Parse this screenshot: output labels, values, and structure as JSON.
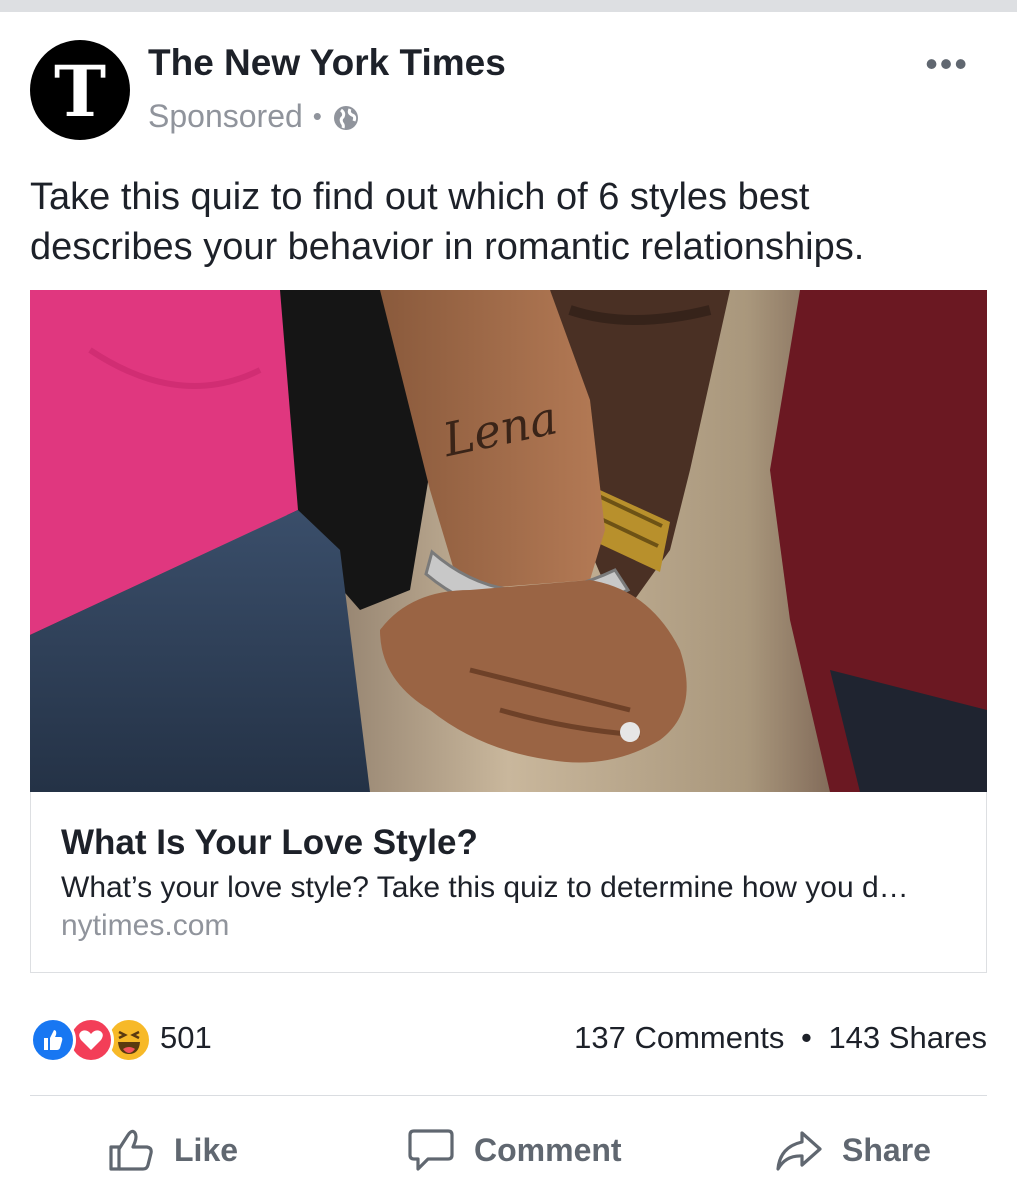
{
  "post": {
    "page_name": "The New York Times",
    "avatar_glyph": "T",
    "sponsored_label": "Sponsored",
    "meta_separator": "•",
    "visibility_icon": "globe-icon",
    "more_label": "•••",
    "text": "Take this quiz to find out which of 6 styles best describes your behavior in romantic relationships."
  },
  "link_card": {
    "image_tattoo_text": "Lena",
    "title": "What Is Your Love Style?",
    "description": "What’s your love style? Take this quiz to determine how you d…",
    "domain": "nytimes.com"
  },
  "engagement": {
    "reaction_icons": [
      "like-reaction-icon",
      "love-reaction-icon",
      "haha-reaction-icon"
    ],
    "reaction_count": "501",
    "comments": "137 Comments",
    "separator": "•",
    "shares": "143 Shares"
  },
  "actions": {
    "like": "Like",
    "comment": "Comment",
    "share": "Share"
  },
  "colors": {
    "text_primary": "#1d2129",
    "text_secondary": "#90949c",
    "action_gray": "#606770",
    "like_blue": "#1877f2",
    "love_red": "#f33e58",
    "haha_yellow": "#f7b928"
  }
}
